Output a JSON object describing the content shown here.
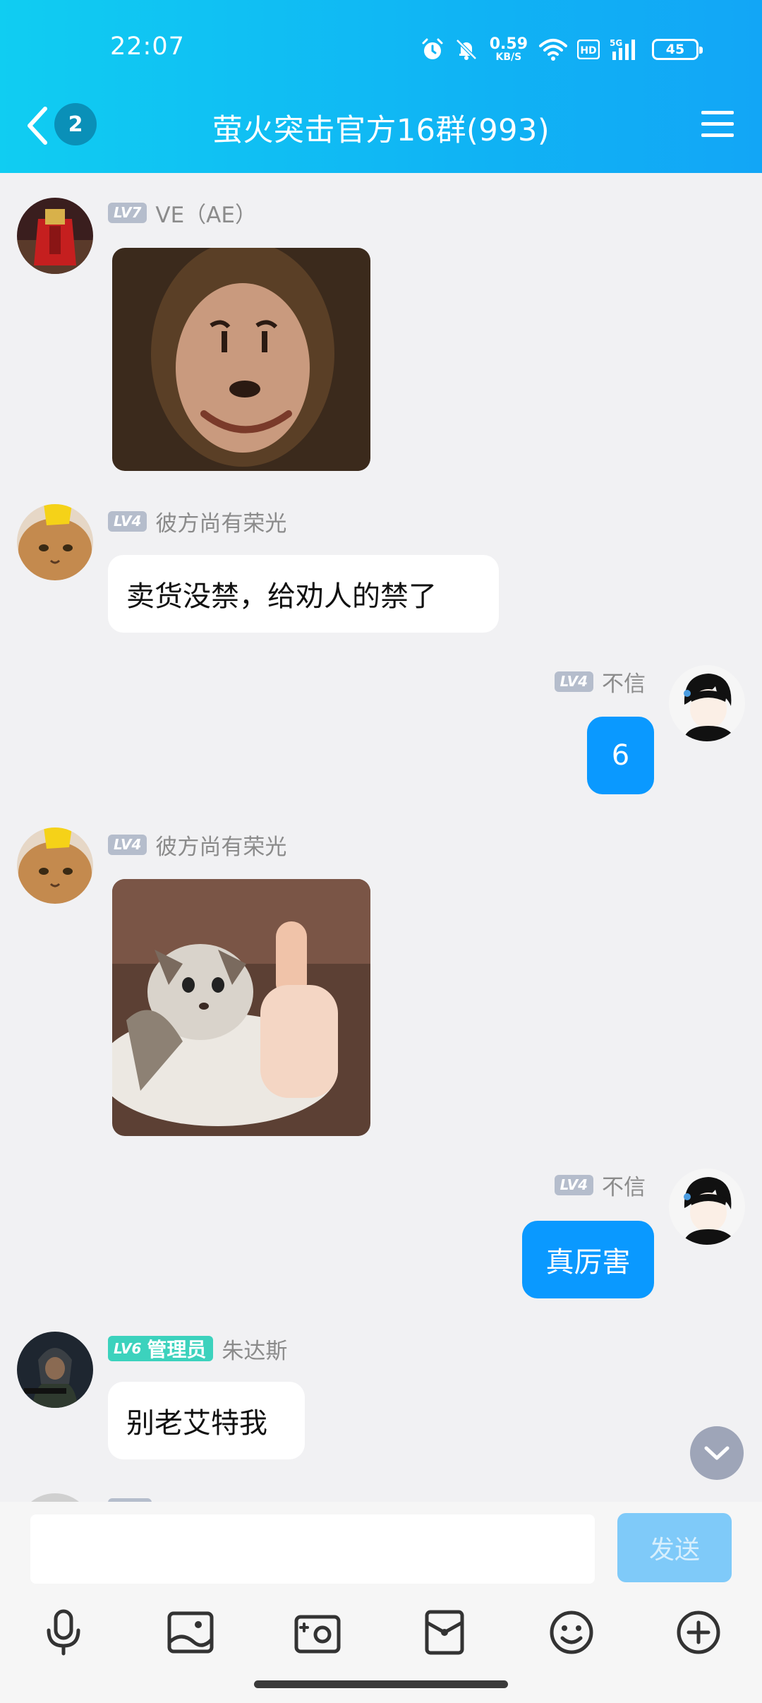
{
  "status_bar": {
    "time": "22:07",
    "net_speed": "0.59",
    "net_unit": "KB/S",
    "battery": "45",
    "icons": [
      "alarm-icon",
      "mute-bell-icon",
      "wifi-icon",
      "hd-icon",
      "5g-signal-icon"
    ]
  },
  "nav": {
    "unread_count": "2",
    "title": "萤火突击官方16群(993)"
  },
  "messages": [
    {
      "side": "left",
      "level": "LV7",
      "nick": "VE（AE）",
      "type": "image",
      "image": "meme-face-sticker"
    },
    {
      "side": "left",
      "level": "LV4",
      "nick": "彼方尚有荣光",
      "type": "text",
      "text": "卖货没禁，给劝人的禁了"
    },
    {
      "side": "right",
      "level": "LV4",
      "nick": "不信",
      "type": "text",
      "text": "6"
    },
    {
      "side": "left",
      "level": "LV4",
      "nick": "彼方尚有荣光",
      "type": "image",
      "image": "cat-thumbs-up-sticker"
    },
    {
      "side": "right",
      "level": "LV4",
      "nick": "不信",
      "type": "text",
      "text": "真厉害"
    },
    {
      "side": "left",
      "level": "LV6",
      "badge": "管理员",
      "nick": "朱达斯",
      "type": "text",
      "text": "别老艾特我"
    }
  ],
  "input": {
    "placeholder": "",
    "send_label": "发送"
  },
  "toolbar_icons": [
    "microphone-icon",
    "photo-icon",
    "camera-icon",
    "red-packet-icon",
    "emoji-icon",
    "plus-icon"
  ],
  "colors": {
    "header_start": "#10cdf2",
    "header_end": "#12a6f6",
    "own_bubble": "#0a99ff",
    "admin_badge": "#3cd2bd",
    "level_badge": "#b5bdcc",
    "send_button": "#7fcaf9"
  }
}
